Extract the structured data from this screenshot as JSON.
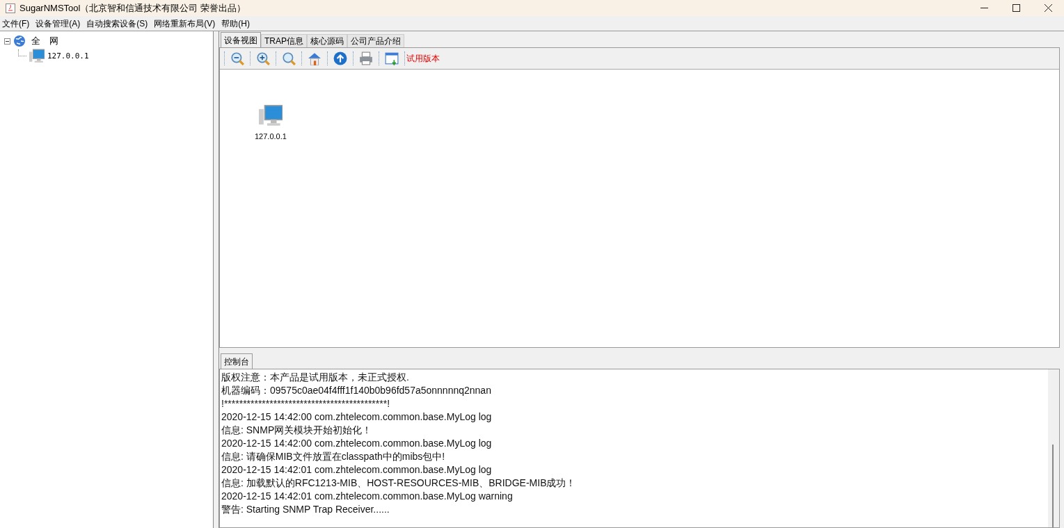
{
  "window": {
    "title": "SugarNMSTool（北京智和信通技术有限公司 荣誉出品）"
  },
  "menu": [
    "文件(F)",
    "设备管理(A)",
    "自动搜索设备(S)",
    "网络重新布局(V)",
    "帮助(H)"
  ],
  "tree": [
    {
      "label": "全　网",
      "kind": "network",
      "expanded": true,
      "children": [
        {
          "label": "127.0.0.1",
          "kind": "host"
        }
      ]
    }
  ],
  "tabs": [
    {
      "label": "设备视图",
      "selected": true
    },
    {
      "label": "TRAP信息",
      "selected": false
    },
    {
      "label": "核心源码",
      "selected": false
    },
    {
      "label": "公司产品介绍",
      "selected": false
    }
  ],
  "toolbar": {
    "tools": [
      {
        "kind": "zoom-out"
      },
      {
        "kind": "zoom-in"
      },
      {
        "kind": "zoom"
      },
      {
        "kind": "home"
      },
      {
        "kind": "up"
      },
      {
        "kind": "print"
      },
      {
        "kind": "export"
      }
    ],
    "notice": "试用版本"
  },
  "canvas": {
    "nodes": [
      {
        "label": "127.0.0.1"
      }
    ]
  },
  "console": {
    "tab": {
      "label": "控制台",
      "selected": true
    },
    "lines": [
      "版权注意：本产品是试用版本，未正式授权.",
      "机器编码：09575c0ae04f4fff1f140b0b96fd57a5onnnnnq2nnan",
      "!*******************************************!",
      "2020-12-15 14:42:00 com.zhtelecom.common.base.MyLog log",
      "信息: SNMP网关模块开始初始化！",
      "2020-12-15 14:42:00 com.zhtelecom.common.base.MyLog log",
      "信息: 请确保MIB文件放置在classpath中的mibs包中!",
      "2020-12-15 14:42:01 com.zhtelecom.common.base.MyLog log",
      "信息: 加载默认的RFC1213-MIB、HOST-RESOURCES-MIB、BRIDGE-MIB成功！",
      "2020-12-15 14:42:01 com.zhtelecom.common.base.MyLog warning",
      "警告: Starting SNMP Trap Receiver......"
    ]
  }
}
